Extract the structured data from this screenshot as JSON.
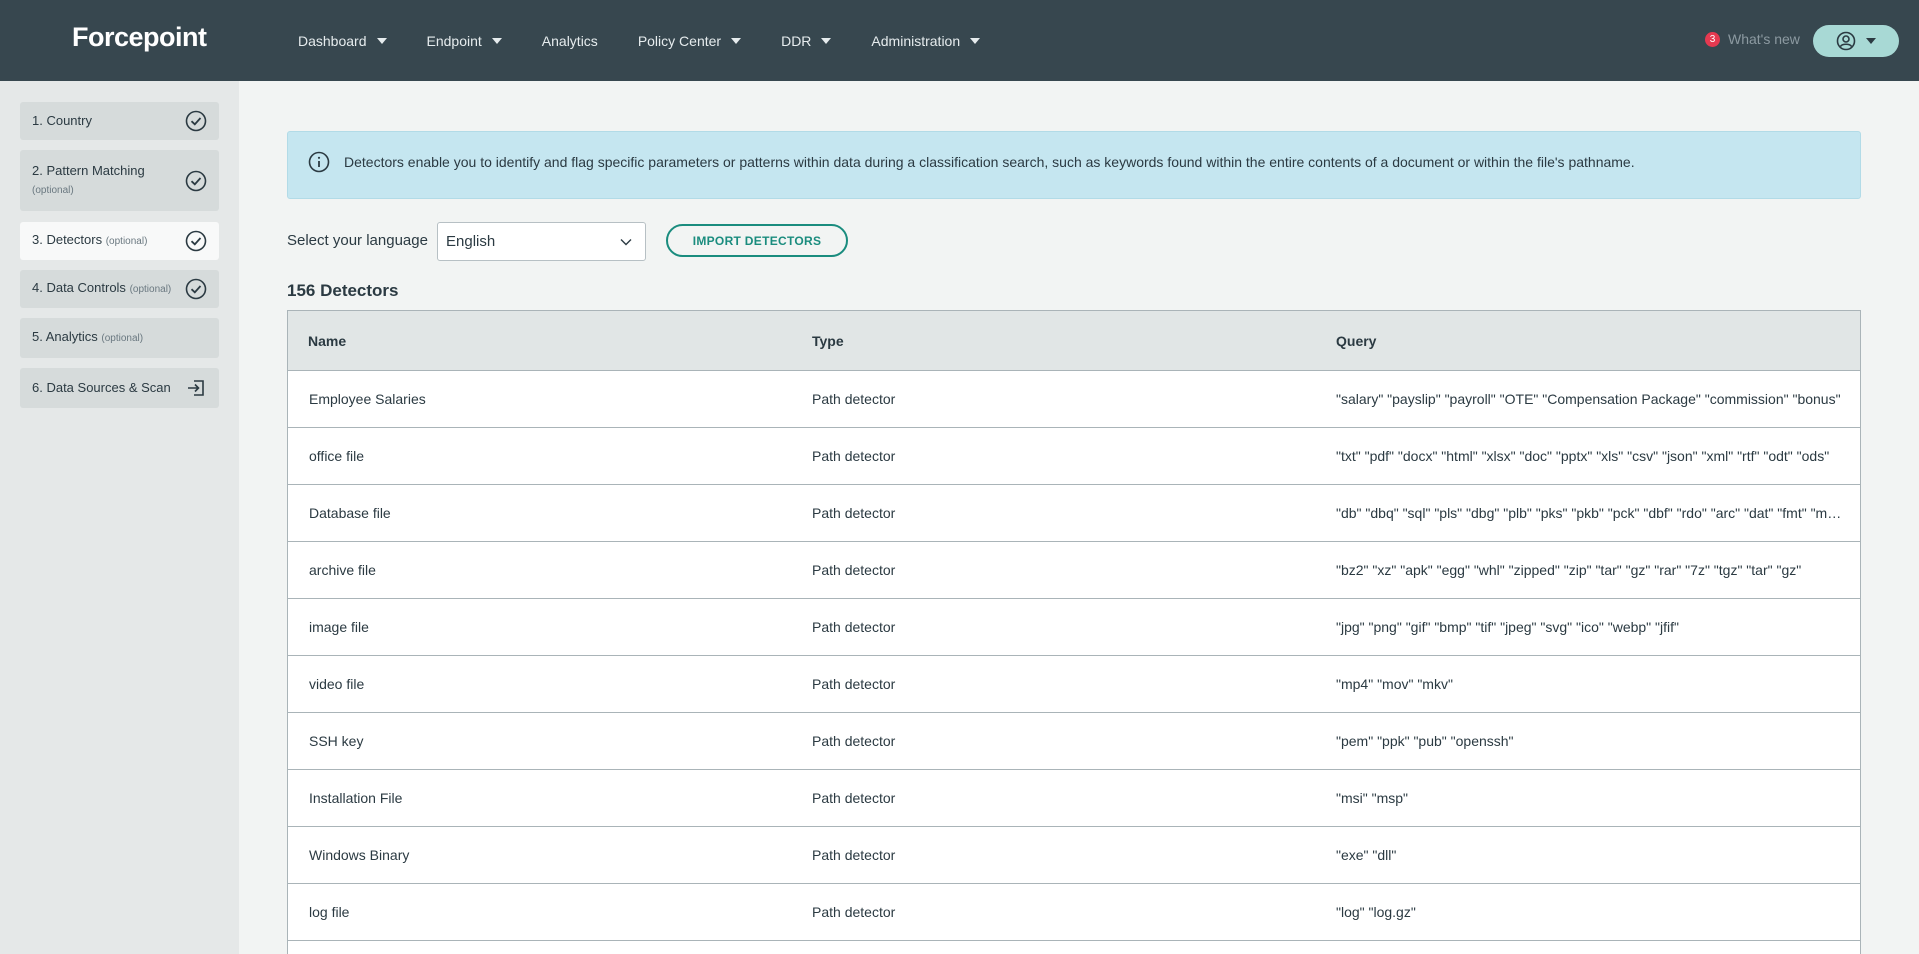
{
  "brand": "Forcepoint",
  "nav": {
    "items": [
      {
        "label": "Dashboard",
        "dropdown": true
      },
      {
        "label": "Endpoint",
        "dropdown": true
      },
      {
        "label": "Analytics",
        "dropdown": false
      },
      {
        "label": "Policy Center",
        "dropdown": true
      },
      {
        "label": "DDR",
        "dropdown": true
      },
      {
        "label": "Administration",
        "dropdown": true
      }
    ],
    "whats_new_count": "3",
    "whats_new_label": "What's new"
  },
  "sidebar": {
    "steps": [
      {
        "label": "1. Country",
        "optional": "",
        "icon": "check-circle-icon"
      },
      {
        "label": "2. Pattern Matching",
        "optional": "(optional)",
        "icon": "check-circle-icon"
      },
      {
        "label": "3. Detectors",
        "optional": "(optional)",
        "icon": "check-circle-icon"
      },
      {
        "label": "4. Data Controls",
        "optional": "(optional)",
        "icon": "check-circle-icon"
      },
      {
        "label": "5. Analytics",
        "optional": "(optional)",
        "icon": ""
      },
      {
        "label": "6. Data Sources & Scan",
        "optional": "",
        "icon": "enter-icon"
      }
    ]
  },
  "info": {
    "text": "Detectors enable you to identify and flag specific parameters or patterns within data during a classification search, such as keywords found within the entire contents of a document or within the file's pathname."
  },
  "language": {
    "label": "Select your language",
    "value": "English"
  },
  "import_label": "IMPORT DETECTORS",
  "count_label": "156 Detectors",
  "table": {
    "headers": {
      "name": "Name",
      "type": "Type",
      "query": "Query"
    },
    "rows": [
      {
        "name": "Employee Salaries",
        "type": "Path detector",
        "query": "\"salary\" \"payslip\" \"payroll\" \"OTE\" \"Compensation Package\" \"commission\" \"bonus\""
      },
      {
        "name": "office file",
        "type": "Path detector",
        "query": "\"txt\" \"pdf\" \"docx\" \"html\" \"xlsx\" \"doc\" \"pptx\" \"xls\" \"csv\" \"json\" \"xml\" \"rtf\" \"odt\" \"ods\""
      },
      {
        "name": "Database file",
        "type": "Path detector",
        "query": "\"db\" \"dbq\" \"sql\" \"pls\" \"dbg\" \"plb\" \"pks\" \"pkb\" \"pck\" \"dbf\" \"rdo\" \"arc\" \"dat\" \"fmt\" \"mdb\""
      },
      {
        "name": "archive file",
        "type": "Path detector",
        "query": "\"bz2\" \"xz\" \"apk\" \"egg\" \"whl\" \"zipped\" \"zip\" \"tar\" \"gz\" \"rar\" \"7z\" \"tgz\" \"tar\" \"gz\""
      },
      {
        "name": "image file",
        "type": "Path detector",
        "query": "\"jpg\" \"png\" \"gif\" \"bmp\" \"tif\" \"jpeg\" \"svg\" \"ico\" \"webp\" \"jfif\""
      },
      {
        "name": "video file",
        "type": "Path detector",
        "query": "\"mp4\" \"mov\" \"mkv\""
      },
      {
        "name": "SSH key",
        "type": "Path detector",
        "query": "\"pem\" \"ppk\" \"pub\" \"openssh\""
      },
      {
        "name": "Installation File",
        "type": "Path detector",
        "query": "\"msi\" \"msp\""
      },
      {
        "name": "Windows Binary",
        "type": "Path detector",
        "query": "\"exe\" \"dll\""
      },
      {
        "name": "log file",
        "type": "Path detector",
        "query": "\"log\" \"log.gz\""
      }
    ]
  },
  "colors": {
    "topbar": "#37474f",
    "accent": "#1a8c7e",
    "info_bg": "#c5e6f0",
    "badge": "#e53950"
  }
}
